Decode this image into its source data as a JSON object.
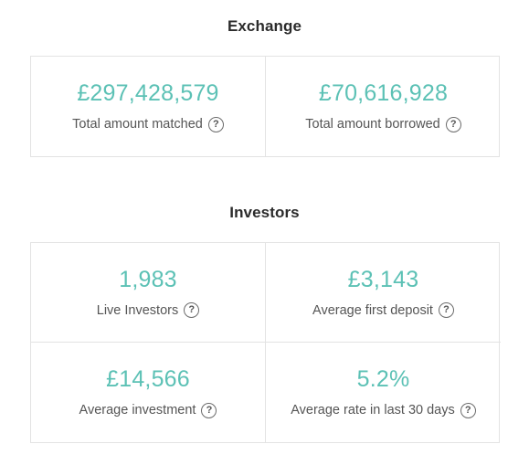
{
  "exchange": {
    "title": "Exchange",
    "stats": [
      {
        "value": "£297,428,579",
        "label": "Total amount matched",
        "help_glyph": "?"
      },
      {
        "value": "£70,616,928",
        "label": "Total amount borrowed",
        "help_glyph": "?"
      }
    ]
  },
  "investors": {
    "title": "Investors",
    "stats": [
      {
        "value": "1,983",
        "label": "Live Investors",
        "help_glyph": "?"
      },
      {
        "value": "£3,143",
        "label": "Average first deposit",
        "help_glyph": "?"
      },
      {
        "value": "£14,566",
        "label": "Average investment",
        "help_glyph": "?"
      },
      {
        "value": "5.2%",
        "label": "Average rate in last 30 days",
        "help_glyph": "?"
      }
    ]
  },
  "colors": {
    "accent_value": "#5cc1b5",
    "border": "#e3e3e3",
    "label_text": "#555555",
    "title_text": "#2b2b2b"
  },
  "icons": {
    "help": "question-circle-icon"
  }
}
